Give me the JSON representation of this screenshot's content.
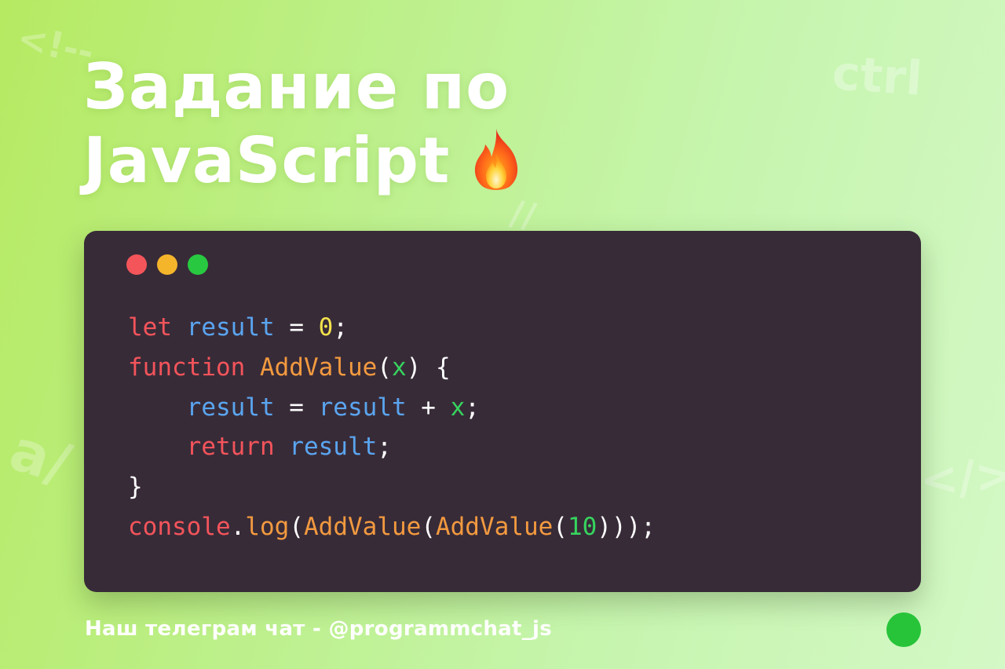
{
  "background_glyphs": {
    "top_left": "<!--",
    "top_right": "ctrl",
    "middle": "//",
    "left_bottom": "a/",
    "right_bottom": "</>"
  },
  "title": {
    "line1": "Задание по",
    "line2": "JavaScript",
    "emoji_icon": "fire-icon"
  },
  "window_controls": {
    "colors": {
      "red": "#f4555a",
      "yellow": "#f5b52b",
      "green": "#28c940"
    }
  },
  "code": {
    "colors": {
      "keyword": "#f4545b",
      "identifier": "#5aa5f0",
      "function_name": "#f39a3f",
      "number": "#f2e24c",
      "param": "#36d45e",
      "punct": "#ffffff"
    },
    "lines": [
      [
        {
          "t": "let",
          "c": "keyword"
        },
        {
          "t": " ",
          "c": "punct"
        },
        {
          "t": "result",
          "c": "identifier"
        },
        {
          "t": " = ",
          "c": "punct"
        },
        {
          "t": "0",
          "c": "number"
        },
        {
          "t": ";",
          "c": "punct"
        }
      ],
      [
        {
          "t": "function",
          "c": "keyword"
        },
        {
          "t": " ",
          "c": "punct"
        },
        {
          "t": "AddValue",
          "c": "function_name"
        },
        {
          "t": "(",
          "c": "punct"
        },
        {
          "t": "x",
          "c": "param"
        },
        {
          "t": ") {",
          "c": "punct"
        }
      ],
      [
        {
          "t": "    ",
          "c": "punct"
        },
        {
          "t": "result",
          "c": "identifier"
        },
        {
          "t": " = ",
          "c": "punct"
        },
        {
          "t": "result",
          "c": "identifier"
        },
        {
          "t": " + ",
          "c": "punct"
        },
        {
          "t": "x",
          "c": "param"
        },
        {
          "t": ";",
          "c": "punct"
        }
      ],
      [
        {
          "t": "    ",
          "c": "punct"
        },
        {
          "t": "return",
          "c": "keyword"
        },
        {
          "t": " ",
          "c": "punct"
        },
        {
          "t": "result",
          "c": "identifier"
        },
        {
          "t": ";",
          "c": "punct"
        }
      ],
      [
        {
          "t": "}",
          "c": "punct"
        }
      ],
      [
        {
          "t": "console",
          "c": "keyword"
        },
        {
          "t": ".",
          "c": "punct"
        },
        {
          "t": "log",
          "c": "function_name"
        },
        {
          "t": "(",
          "c": "punct"
        },
        {
          "t": "AddValue",
          "c": "function_name"
        },
        {
          "t": "(",
          "c": "punct"
        },
        {
          "t": "AddValue",
          "c": "function_name"
        },
        {
          "t": "(",
          "c": "punct"
        },
        {
          "t": "10",
          "c": "param"
        },
        {
          "t": ")));",
          "c": "punct"
        }
      ]
    ]
  },
  "footer": {
    "text": "Наш телеграм чат - @programmchat_js",
    "dot_color": "#27c43a"
  }
}
